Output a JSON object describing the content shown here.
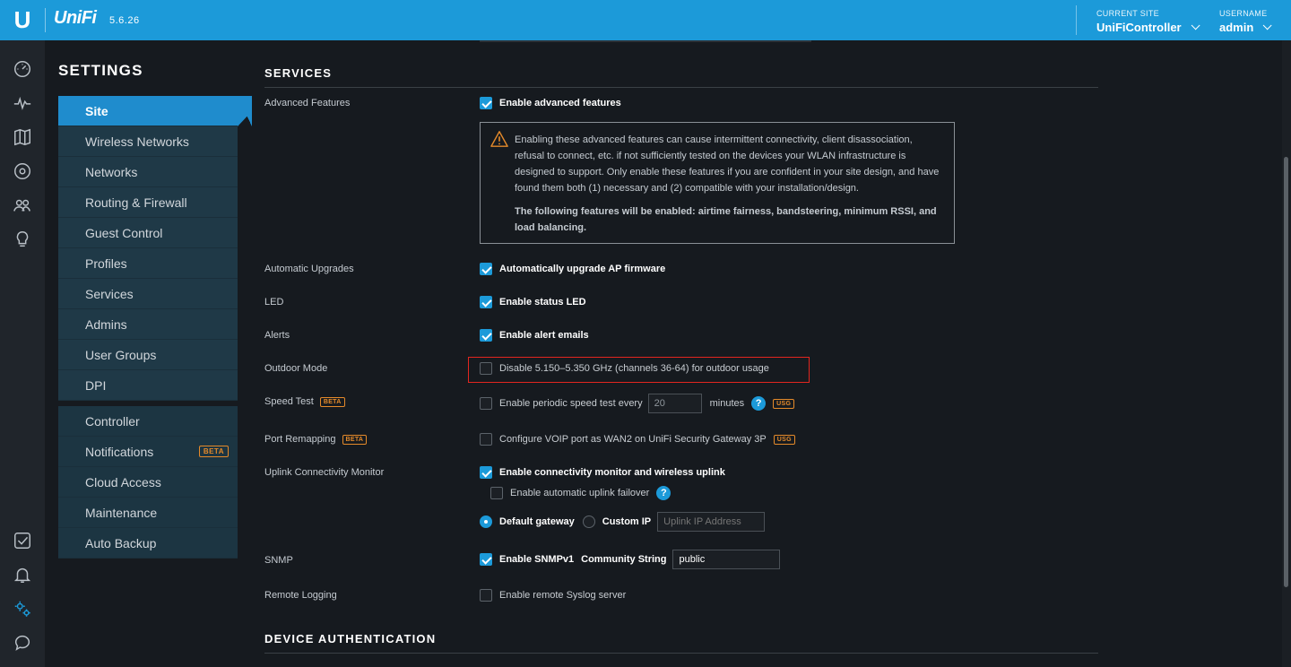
{
  "header": {
    "logo_letter": "U",
    "brand": "UniFi",
    "version": "5.6.26",
    "current_site_label": "CURRENT SITE",
    "current_site_value": "UniFiController",
    "username_label": "USERNAME",
    "username_value": "admin"
  },
  "rail": {
    "icons": [
      "dashboard-icon",
      "statistics-icon",
      "map-icon",
      "devices-icon",
      "clients-icon",
      "insights-icon",
      "events-icon",
      "alerts-icon",
      "settings-icon",
      "chat-icon"
    ]
  },
  "settings": {
    "title": "SETTINGS",
    "nav_site": [
      "Site",
      "Wireless Networks",
      "Networks",
      "Routing & Firewall",
      "Guest Control",
      "Profiles",
      "Services",
      "Admins",
      "User Groups",
      "DPI"
    ],
    "nav_controller": [
      "Controller",
      "Notifications",
      "Cloud Access",
      "Maintenance",
      "Auto Backup"
    ],
    "beta": "BETA"
  },
  "services": {
    "title": "SERVICES",
    "advanced": {
      "label": "Advanced Features",
      "checkbox": "Enable advanced features",
      "checked": true,
      "warning_text": "Enabling these advanced features can cause intermittent connectivity, client disassociation, refusal to connect, etc. if not sufficiently tested on the devices your WLAN infrastructure is designed to support. Only enable these features if you are confident in your site design, and have found them both (1) necessary and (2) compatible with your installation/design.",
      "warning_bold": "The following features will be enabled: airtime fairness, bandsteering, minimum RSSI, and load balancing."
    },
    "upgrades": {
      "label": "Automatic Upgrades",
      "checkbox": "Automatically upgrade AP firmware"
    },
    "led": {
      "label": "LED",
      "checkbox": "Enable status LED"
    },
    "alerts": {
      "label": "Alerts",
      "checkbox": "Enable alert emails"
    },
    "outdoor": {
      "label": "Outdoor Mode",
      "checkbox": "Disable 5.150–5.350 GHz (channels 36-64) for outdoor usage"
    },
    "speedtest": {
      "label": "Speed Test",
      "beta": "BETA",
      "checkbox": "Enable periodic speed test every",
      "value": "20",
      "unit": "minutes",
      "usg": "USG"
    },
    "portremap": {
      "label": "Port Remapping",
      "beta": "BETA",
      "checkbox": "Configure VOIP port as WAN2 on UniFi Security Gateway 3P",
      "usg": "USG"
    },
    "uplink": {
      "label": "Uplink Connectivity Monitor",
      "checkbox": "Enable connectivity monitor and wireless uplink",
      "failover": "Enable automatic uplink failover",
      "radio_default": "Default gateway",
      "radio_custom": "Custom IP",
      "ip_placeholder": "Uplink IP Address"
    },
    "snmp": {
      "label": "SNMP",
      "checkbox": "Enable SNMPv1",
      "community_label": "Community String",
      "community_value": "public"
    },
    "remote_logging": {
      "label": "Remote Logging",
      "checkbox": "Enable remote Syslog server"
    }
  },
  "device_auth": {
    "title": "DEVICE AUTHENTICATION"
  },
  "colors": {
    "accent": "#1c9ad9",
    "warning": "#e58a2a",
    "highlight": "#e2261f"
  }
}
